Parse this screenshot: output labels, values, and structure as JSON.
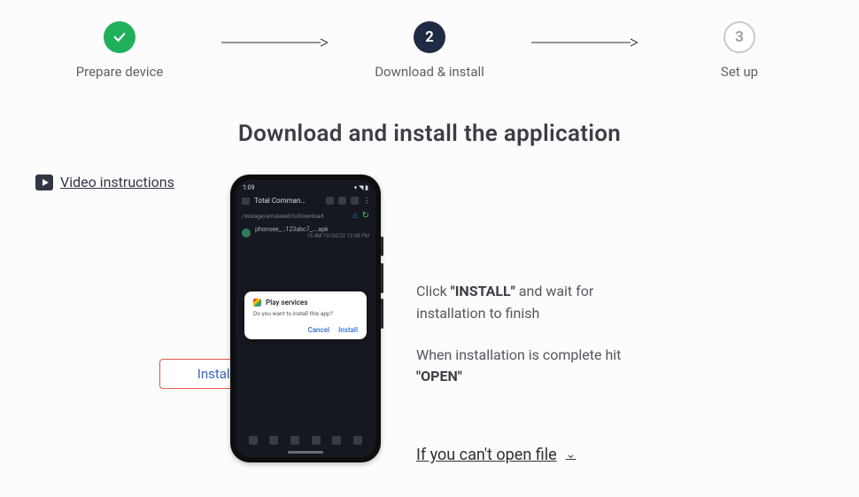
{
  "stepper": {
    "steps": [
      {
        "label": "Prepare device"
      },
      {
        "num": "2",
        "label": "Download & install"
      },
      {
        "num": "3",
        "label": "Set up"
      }
    ]
  },
  "heading": "Download and install the application",
  "video_link": " Video instructions",
  "phone": {
    "time": "1:09",
    "status_right": "▾ ◥ ▮",
    "app_name": "Total Comman…",
    "sub_path": "/storage/emulated/0/Download",
    "file_name": "phonsee_…123abc7_….apk",
    "file_meta": "15.4M   10/24/22 12:48 PM",
    "modal": {
      "title": "Play services",
      "subtitle": "Do you want to install this app?",
      "cancel": "Cancel",
      "install": "Install"
    }
  },
  "callout": "Install",
  "instructions": {
    "line1_prefix": "Click ",
    "line1_bold": "\"INSTALL\"",
    "line1_suffix": " and wait for installation to finish",
    "line2_prefix": "When installation is complete hit ",
    "line2_bold": "\"OPEN\""
  },
  "cant_open": "If you can't open file"
}
